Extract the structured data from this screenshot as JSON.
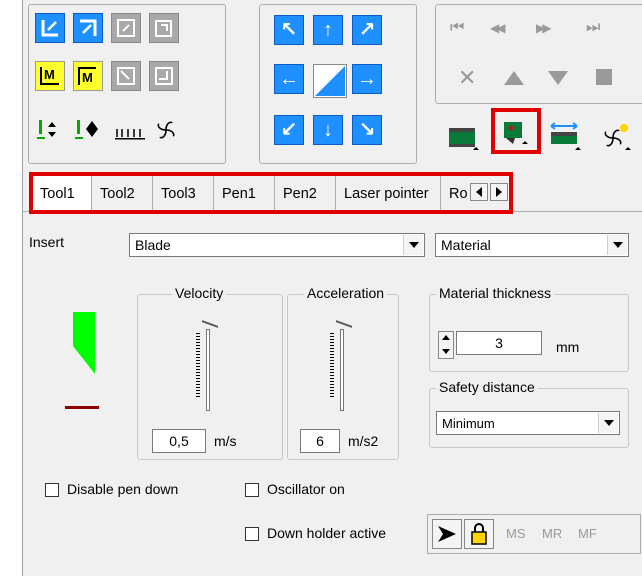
{
  "toolbar": {
    "transport": {
      "first": "⏮",
      "prev": "◀◀",
      "next": "▶▶",
      "last": "⏭"
    },
    "mini_labels": {
      "m1": "M",
      "m2": "M"
    },
    "tool_icons": [
      "tool-holder-1",
      "tool-holder-2-active",
      "tool-holder-3",
      "fan-with-indicator"
    ]
  },
  "tabs": [
    {
      "label": "Tool1",
      "active": true
    },
    {
      "label": "Tool2"
    },
    {
      "label": "Tool3"
    },
    {
      "label": "Pen1"
    },
    {
      "label": "Pen2"
    },
    {
      "label": "Laser pointer"
    },
    {
      "label": "Ro"
    }
  ],
  "form": {
    "insert_label": "Insert",
    "insert_value": "Blade",
    "material_value": "Material",
    "velocity": {
      "legend": "Velocity",
      "value": "0,5",
      "unit": "m/s"
    },
    "acceleration": {
      "legend": "Acceleration",
      "value": "6",
      "unit": "m/s2"
    },
    "material_thickness": {
      "legend": "Material thickness",
      "value": "3",
      "unit": "mm"
    },
    "safety_distance": {
      "legend": "Safety distance",
      "value": "Minimum"
    },
    "disable_pen_down": "Disable pen down",
    "oscillator_on": "Oscillator on",
    "down_holder_active": "Down holder active",
    "ms": "MS",
    "mr": "MR",
    "mf": "MF"
  },
  "colors": {
    "accent_blue": "#1e90ff",
    "highlight_red": "#e00000",
    "tool_green": "#00ff00",
    "tool_dark_red": "#8b0000"
  }
}
